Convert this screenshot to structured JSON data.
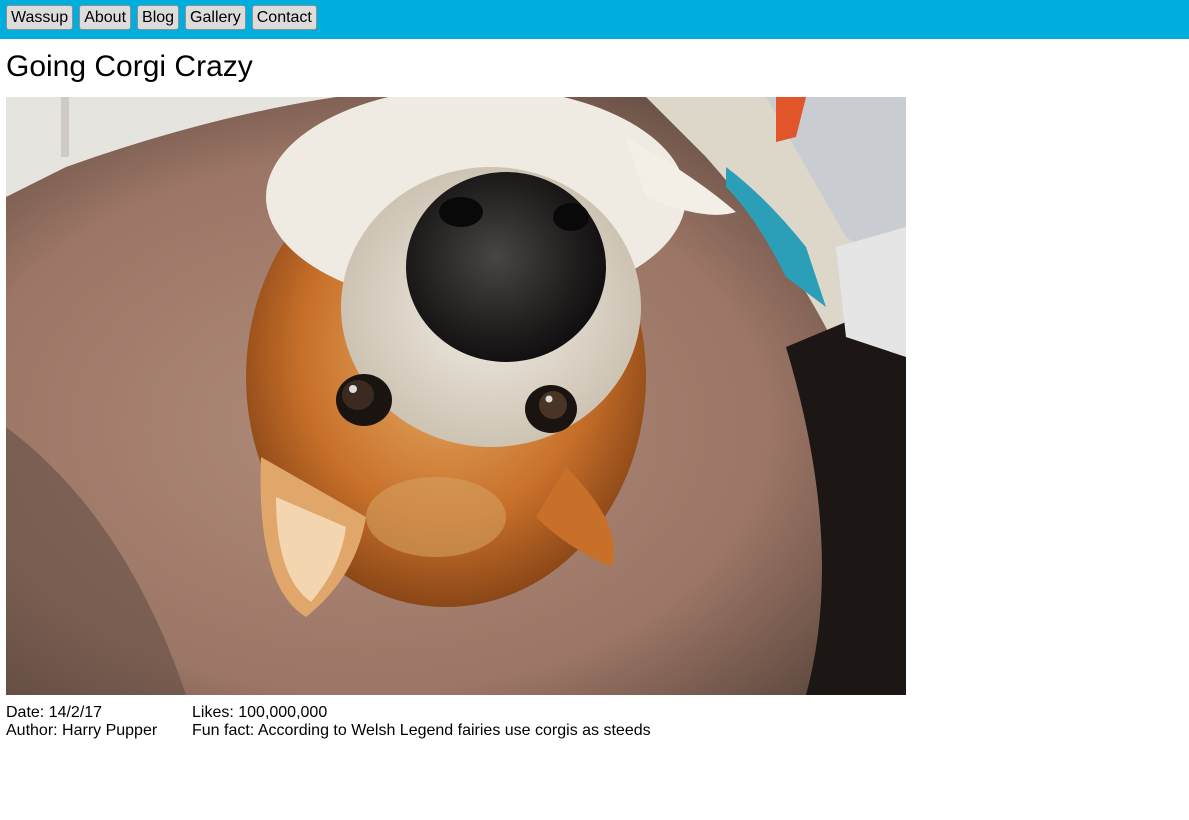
{
  "nav": {
    "items": [
      {
        "label": "Wassup"
      },
      {
        "label": "About"
      },
      {
        "label": "Blog"
      },
      {
        "label": "Gallery"
      },
      {
        "label": "Contact"
      }
    ],
    "color": "#00aedd"
  },
  "post": {
    "title": "Going Corgi Crazy",
    "date": "Date: 14/2/17",
    "author": "Author: Harry Pupper",
    "likes": "Likes: 100,000,000",
    "fun_fact": "Fun fact: According to Welsh Legend fairies use corgis as steeds"
  }
}
